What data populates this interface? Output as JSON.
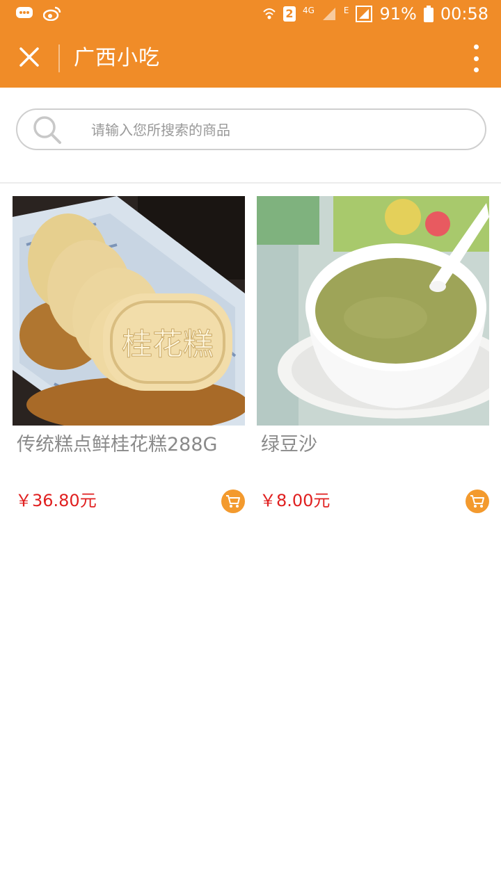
{
  "status_bar": {
    "network_badge": "2",
    "network_type": "4G",
    "network_edge": "E",
    "battery": "91%",
    "time": "00:58"
  },
  "header": {
    "title": "广西小吃"
  },
  "search": {
    "placeholder": "请输入您所搜索的商品"
  },
  "products": [
    {
      "name": "传统糕点鲜桂花糕288G",
      "price": "￥36.80元"
    },
    {
      "name": "绿豆沙",
      "price": "￥8.00元"
    }
  ],
  "colors": {
    "accent": "#f08c28",
    "price": "#e02020",
    "cart": "#f39a2e"
  }
}
